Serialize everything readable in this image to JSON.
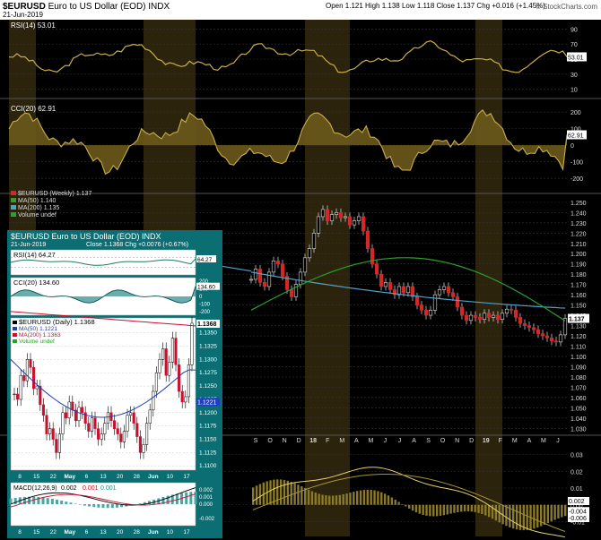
{
  "header": {
    "symbol": "$EURUSD",
    "name": "Euro to US Dollar (EOD)",
    "exchange": "INDX",
    "date": "21-Jun-2019",
    "quote": "Open 1.121  High 1.138  Low 1.118  Close 1.137  Chg +0.016 (+1.45%)",
    "logo": "© StockCharts.com"
  },
  "chart_data": [
    {
      "type": "line",
      "panel": "weekly-rsi",
      "label": "RSI(14) 53.01",
      "current": "53.01",
      "yticks": [
        90,
        70,
        50,
        30,
        10
      ],
      "ylim": [
        0,
        100
      ]
    },
    {
      "type": "area",
      "panel": "weekly-cci",
      "label": "CCI(20) 62.91",
      "current": "62.91",
      "yticks": [
        200,
        100,
        0,
        -100,
        -200
      ],
      "ylim": [
        -280,
        260
      ]
    },
    {
      "type": "candlestick",
      "panel": "weekly-price",
      "legend": [
        {
          "label": "$EURUSD (Weekly) 1.137",
          "color": "#d62728"
        },
        {
          "label": "MA(50) 1.140",
          "color": "#2ca02c"
        },
        {
          "label": "MA(200) 1.135",
          "color": "#4fa3c8"
        },
        {
          "label": "Volume undef",
          "color": "#2ca02c"
        }
      ],
      "current": "1.137",
      "yticks": [
        "1.250",
        "1.240",
        "1.230",
        "1.220",
        "1.210",
        "1.200",
        "1.190",
        "1.180",
        "1.170",
        "1.160",
        "1.150",
        "1.140",
        "1.130",
        "1.120",
        "1.110",
        "1.100",
        "1.090",
        "1.080",
        "1.070",
        "1.060",
        "1.050",
        "1.040",
        "1.030"
      ],
      "ylim": [
        1.025,
        1.256
      ],
      "xlabels": [
        "S",
        "O",
        "N",
        "D",
        "18",
        "F",
        "M",
        "A",
        "M",
        "J",
        "J",
        "A",
        "S",
        "O",
        "N",
        "D",
        "19",
        "F",
        "M",
        "A",
        "M",
        "J"
      ],
      "closes": [
        1.175,
        1.185,
        1.172,
        1.168,
        1.182,
        1.193,
        1.19,
        1.178,
        1.165,
        1.158,
        1.17,
        1.182,
        1.196,
        1.205,
        1.22,
        1.236,
        1.243,
        1.232,
        1.238,
        1.24,
        1.235,
        1.236,
        1.228,
        1.232,
        1.236,
        1.222,
        1.205,
        1.19,
        1.18,
        1.168,
        1.172,
        1.165,
        1.16,
        1.168,
        1.162,
        1.168,
        1.158,
        1.15,
        1.145,
        1.14,
        1.145,
        1.16,
        1.165,
        1.168,
        1.162,
        1.158,
        1.148,
        1.14,
        1.135,
        1.14,
        1.138,
        1.136,
        1.142,
        1.138,
        1.14,
        1.136,
        1.142,
        1.146,
        1.145,
        1.138,
        1.132,
        1.13,
        1.128,
        1.126,
        1.122,
        1.12,
        1.118,
        1.115,
        1.114,
        1.121,
        1.137
      ]
    },
    {
      "type": "line",
      "panel": "weekly-macd",
      "yticks": [
        "0.03",
        "0.02",
        "0.01",
        "0.00",
        "-0.01"
      ],
      "current": [
        "0.002",
        "-0.004",
        "-0.006"
      ],
      "ylim": [
        -0.014,
        0.034
      ]
    },
    {
      "type": "candlestick",
      "panel": "daily-inset",
      "title": "$EURUSD Euro to US Dollar (EOD) INDX",
      "date": "21-Jun-2019",
      "quote": "Close 1.1368  Chg +0.0076 (+0.67%)",
      "logo": "© StockCharts.com",
      "rsi": {
        "label": "RSI(14) 64.27",
        "current": "64.27",
        "yticks": [
          "70",
          "30"
        ]
      },
      "cci": {
        "label": "CCI(20) 134.60",
        "current": "134.60",
        "yticks": [
          "200",
          "100",
          "0",
          "-100",
          "-200"
        ]
      },
      "legend": [
        {
          "label": "$EURUSD (Daily) 1.1368",
          "color": "#000000"
        },
        {
          "label": "MA(50) 1.1221",
          "color": "#1f3fbf"
        },
        {
          "label": "MA(200) 1.1363",
          "color": "#c8102e"
        },
        {
          "label": "Volume undef",
          "color": "#2ca02c"
        }
      ],
      "current": "1.1368",
      "ma50_value": "1.1221",
      "yticks": [
        "1.1350",
        "1.1325",
        "1.1300",
        "1.1275",
        "1.1250",
        "1.1225",
        "1.1200",
        "1.1175",
        "1.1150",
        "1.1125",
        "1.1100"
      ],
      "ylim": [
        1.1092,
        1.1378
      ],
      "xlabels": [
        "8",
        "15",
        "22",
        "May",
        "6",
        "13",
        "20",
        "28",
        "Jun",
        "10",
        "17"
      ],
      "closes": [
        1.1235,
        1.1225,
        1.127,
        1.126,
        1.13,
        1.1285,
        1.1245,
        1.125,
        1.1215,
        1.1195,
        1.116,
        1.117,
        1.115,
        1.1125,
        1.116,
        1.12,
        1.119,
        1.122,
        1.1205,
        1.1185,
        1.121,
        1.12,
        1.118,
        1.1165,
        1.119,
        1.117,
        1.115,
        1.116,
        1.118,
        1.12,
        1.1185,
        1.117,
        1.116,
        1.1145,
        1.1165,
        1.1195,
        1.12,
        1.118,
        1.1155,
        1.1125,
        1.114,
        1.118,
        1.1205,
        1.124,
        1.1275,
        1.13,
        1.132,
        1.127,
        1.1295,
        1.134,
        1.129,
        1.124,
        1.122,
        1.123,
        1.129,
        1.1368
      ],
      "macd": {
        "label": "MACD(12,26,9)",
        "value": "0.002",
        "signal": "0.001",
        "hist": "0.001",
        "yticks": [
          "0.002",
          "0.001",
          "0.000",
          "-0.002"
        ]
      }
    }
  ]
}
